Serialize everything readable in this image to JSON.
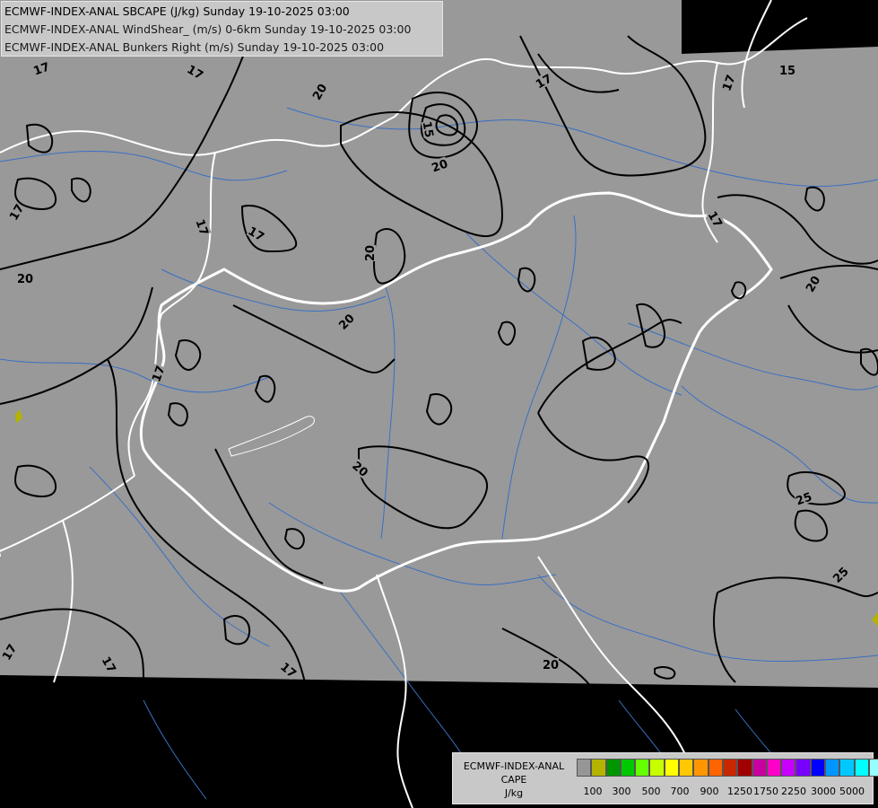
{
  "header": {
    "line1": "ECMWF-INDEX-ANAL SBCAPE (J/kg) Sunday 19-10-2025 03:00",
    "line2": "ECMWF-INDEX-ANAL WindShear_ (m/s) 0-6km Sunday 19-10-2025 03:00",
    "line3": "ECMWF-INDEX-ANAL Bunkers Right (m/s) Sunday 19-10-2025 03:00"
  },
  "legend": {
    "line1": "ECMWF-INDEX-ANAL",
    "line2": "CAPE",
    "line3": "J/kg",
    "colors": [
      "#969696",
      "#b4b400",
      "#009600",
      "#00c800",
      "#64ff00",
      "#c8ff00",
      "#ffff00",
      "#ffc800",
      "#ff9600",
      "#ff6400",
      "#c82800",
      "#a00000",
      "#c800a0",
      "#ff00c8",
      "#c800ff",
      "#7800ff",
      "#0000ff",
      "#0096ff",
      "#00c8ff",
      "#00ffff",
      "#96ffff",
      "#ffffff"
    ],
    "ticks": [
      "100",
      "300",
      "500",
      "700",
      "900",
      "1250",
      "1750",
      "2250",
      "3000",
      "5000"
    ]
  },
  "map": {
    "background_color": "#999999",
    "nodata_color": "#000000",
    "border_color": "#ffffff",
    "river_color": "#3a6fc4",
    "contour_color": "#000000",
    "cape_patch_color": "#b4b400",
    "contour_labels": [
      {
        "text": "17"
      },
      {
        "text": "17"
      },
      {
        "text": "20"
      },
      {
        "text": "17"
      },
      {
        "text": "15"
      },
      {
        "text": "20"
      },
      {
        "text": "20"
      },
      {
        "text": "17"
      },
      {
        "text": "17"
      },
      {
        "text": "15"
      },
      {
        "text": "17"
      },
      {
        "text": "17"
      },
      {
        "text": "20"
      },
      {
        "text": "17"
      },
      {
        "text": "20"
      },
      {
        "text": "20"
      },
      {
        "text": "17"
      },
      {
        "text": "20"
      },
      {
        "text": "25"
      },
      {
        "text": "25"
      },
      {
        "text": "17"
      },
      {
        "text": "17"
      },
      {
        "text": "17"
      },
      {
        "text": "20"
      }
    ]
  }
}
